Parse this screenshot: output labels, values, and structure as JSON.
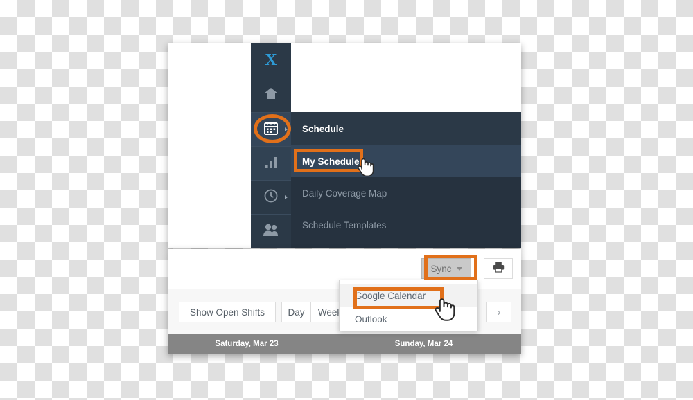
{
  "app": {
    "logo_text": "X"
  },
  "sidebar": {
    "items": [
      {
        "name": "logo",
        "icon": "x-logo-icon",
        "label": ""
      },
      {
        "name": "home",
        "icon": "home-icon",
        "label": ""
      },
      {
        "name": "schedule",
        "icon": "calendar-icon",
        "label": "Schedule",
        "has_arrow": true,
        "selected": true
      },
      {
        "name": "reports",
        "icon": "bar-chart-icon",
        "label": ""
      },
      {
        "name": "time",
        "icon": "clock-icon",
        "label": "",
        "has_arrow": true
      },
      {
        "name": "employees",
        "icon": "people-icon",
        "label": ""
      }
    ]
  },
  "submenu": {
    "header": "Schedule",
    "items": [
      {
        "label": "My Schedule",
        "highlighted": true
      },
      {
        "label": "Daily Coverage Map",
        "highlighted": false
      },
      {
        "label": "Schedule Templates",
        "highlighted": false
      }
    ]
  },
  "toolbar": {
    "sync_label": "Sync",
    "sync_caret_icon": "chevron-down-icon",
    "print_icon": "printer-icon",
    "show_open_shifts_label": "Show Open Shifts",
    "day_label": "Day",
    "week_label": "Week",
    "next_label": "›"
  },
  "sync_dropdown": {
    "options": [
      {
        "label": "Google Calendar",
        "hovered": true
      },
      {
        "label": "Outlook",
        "hovered": false
      }
    ]
  },
  "date_headers": [
    "Saturday, Mar 23",
    "Sunday, Mar 24"
  ],
  "annotations": {
    "highlight_color": "#e1701a",
    "calendar_icon_circled": true,
    "my_schedule_boxed": true,
    "sync_button_boxed": true,
    "google_calendar_boxed": true
  },
  "colors": {
    "accent_orange": "#e1701a",
    "sidebar_dark": "#2b3947",
    "submenu_dark": "#26323f",
    "submenu_highlight": "#34465a",
    "logo_blue": "#2e9bd6",
    "date_bar_gray": "#858585",
    "sync_button_gray": "#c9c9c9"
  }
}
